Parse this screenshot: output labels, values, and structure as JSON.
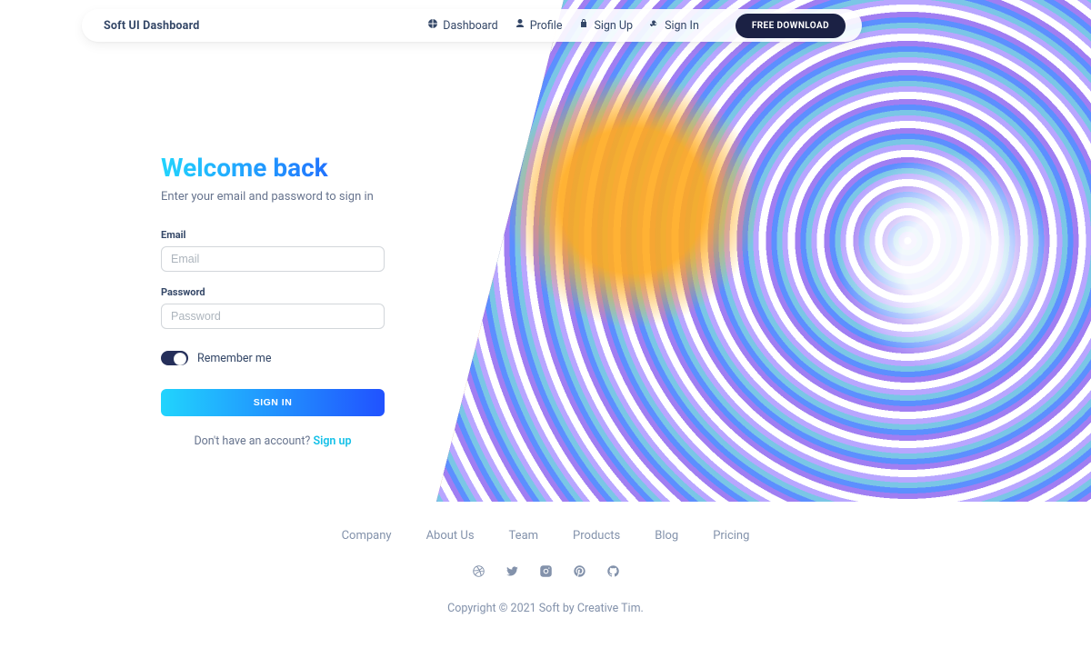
{
  "navbar": {
    "brand": "Soft UI Dashboard",
    "links": {
      "dashboard": "Dashboard",
      "profile": "Profile",
      "signUp": "Sign Up",
      "signIn": "Sign In"
    },
    "cta": "FREE DOWNLOAD"
  },
  "form": {
    "title": "Welcome back",
    "subtitle": "Enter your email and password to sign in",
    "emailLabel": "Email",
    "emailPlaceholder": "Email",
    "passwordLabel": "Password",
    "passwordPlaceholder": "Password",
    "rememberLabel": "Remember me",
    "submit": "SIGN IN",
    "belowText": "Don't have an account? ",
    "belowLink": "Sign up"
  },
  "footer": {
    "links": {
      "company": "Company",
      "about": "About Us",
      "team": "Team",
      "products": "Products",
      "blog": "Blog",
      "pricing": "Pricing"
    },
    "copyright": "Copyright © 2021 Soft by Creative Tim."
  }
}
